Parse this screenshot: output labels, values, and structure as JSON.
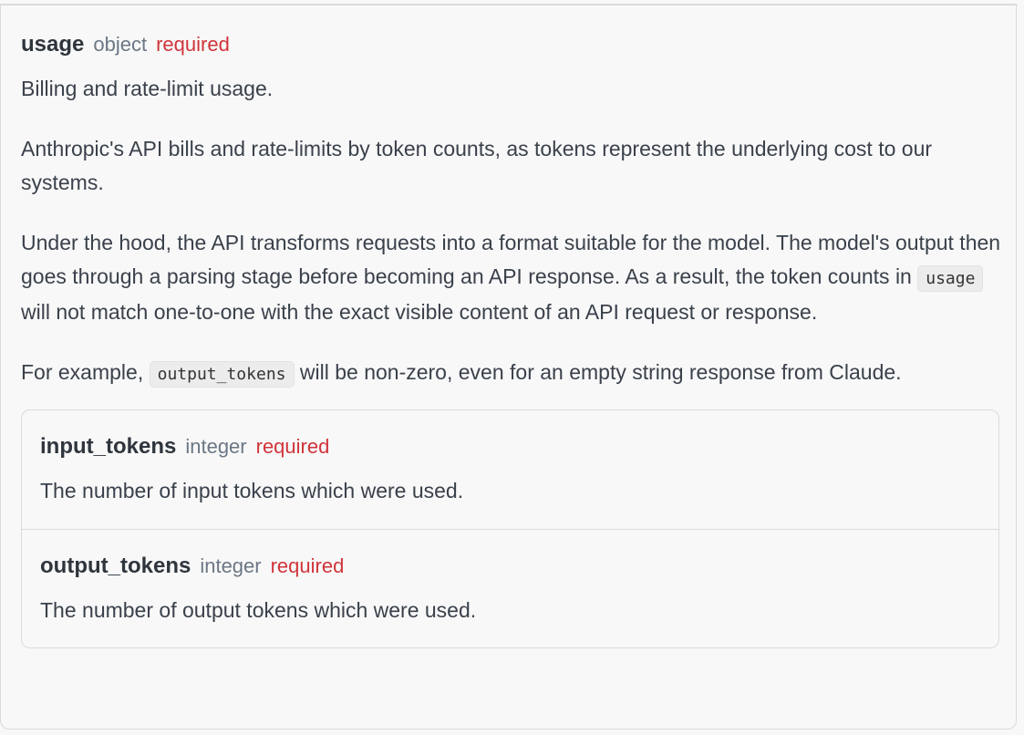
{
  "param": {
    "name": "usage",
    "type": "object",
    "required": "required",
    "description": "Billing and rate-limit usage.",
    "paragraph2": "Anthropic's API bills and rate-limits by token counts, as tokens represent the underlying cost to our systems.",
    "paragraph3": {
      "before_code": "Under the hood, the API transforms requests into a format suitable for the model. The model's output then goes through a parsing stage before becoming an API response. As a result, the token counts in ",
      "code": "usage",
      "after_code": " will not match one-to-one with the exact visible content of an API request or response."
    },
    "paragraph4": {
      "before_code": "For example, ",
      "code": "output_tokens",
      "after_code": " will be non-zero, even for an empty string response from Claude."
    }
  },
  "children": [
    {
      "name": "input_tokens",
      "type": "integer",
      "required": "required",
      "description": "The number of input tokens which were used."
    },
    {
      "name": "output_tokens",
      "type": "integer",
      "required": "required",
      "description": "The number of output tokens which were used."
    }
  ]
}
